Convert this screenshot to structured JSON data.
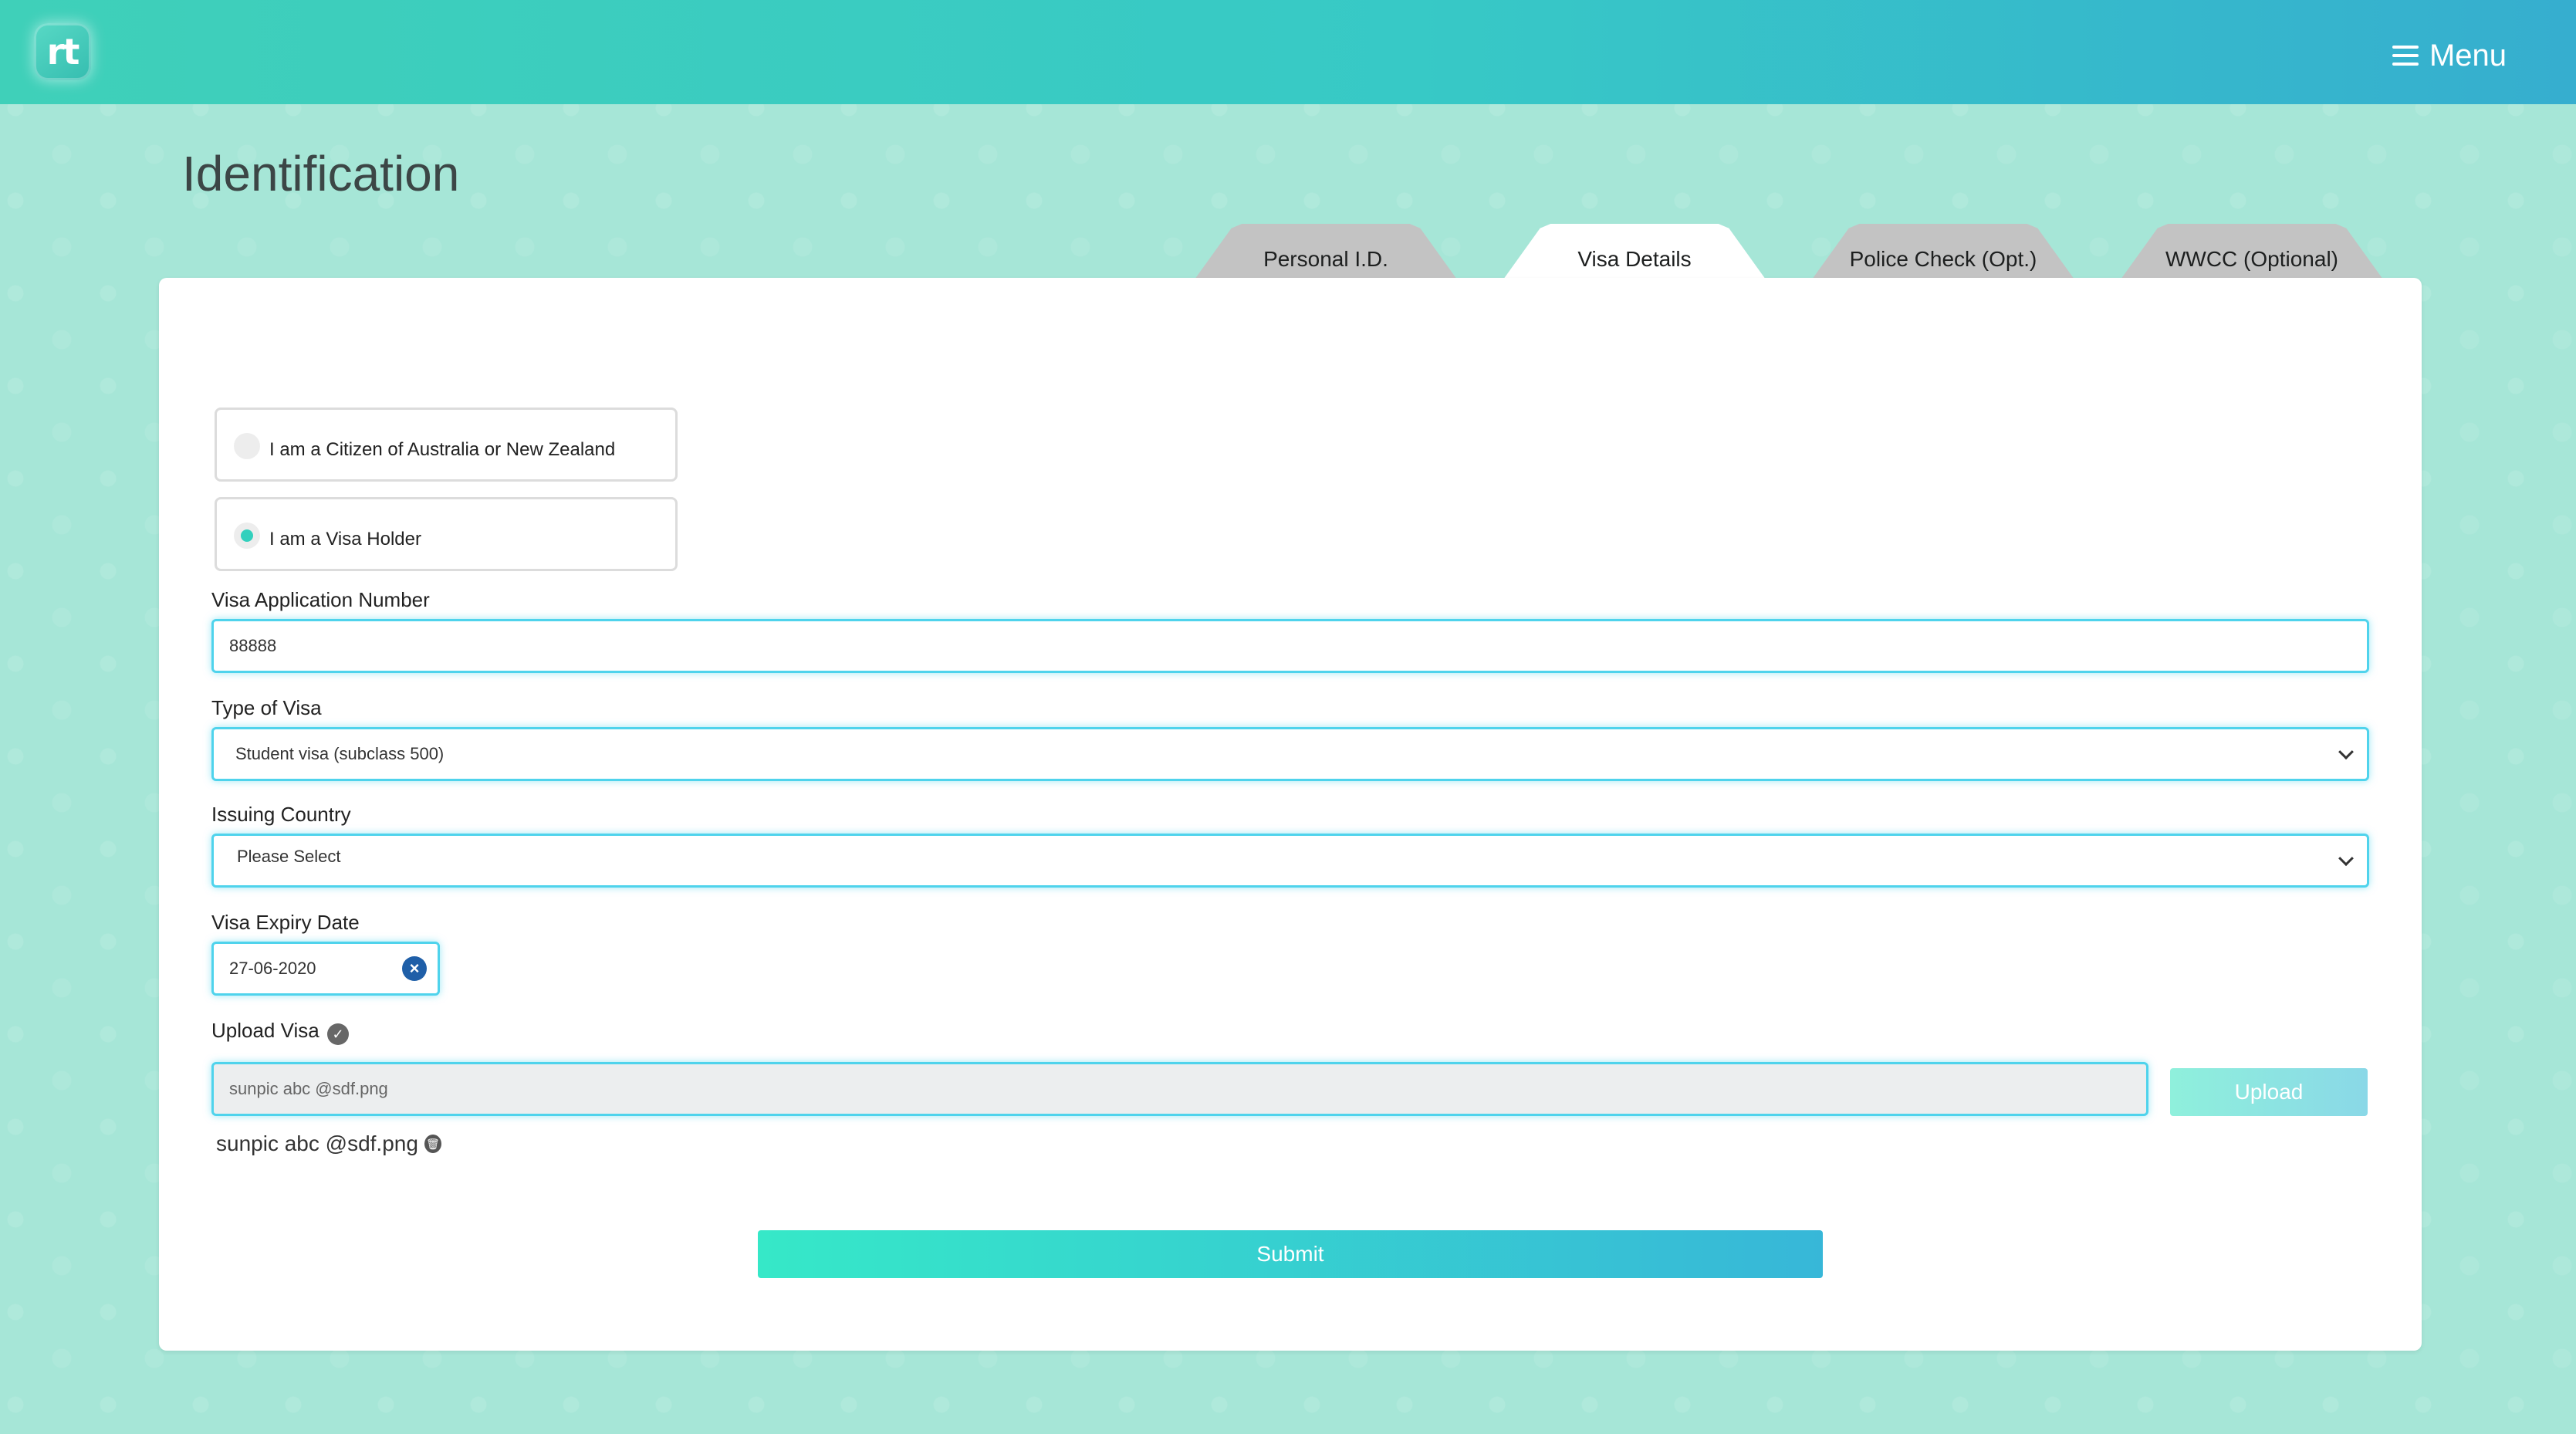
{
  "header": {
    "logo_text": "rt",
    "menu_label": "Menu"
  },
  "page": {
    "title": "Identification"
  },
  "tabs": [
    {
      "label": "Personal I.D."
    },
    {
      "label": "Visa Details"
    },
    {
      "label": "Police Check (Opt.)"
    },
    {
      "label": "WWCC (Optional)"
    }
  ],
  "citizenship": {
    "options": [
      {
        "label": "I am a Citizen of Australia or New Zealand",
        "checked": false
      },
      {
        "label": "I am a Visa Holder",
        "checked": true
      }
    ]
  },
  "form": {
    "visa_application_number": {
      "label": "Visa Application Number",
      "value": "88888"
    },
    "type_of_visa": {
      "label": "Type of Visa",
      "value": "Student visa (subclass 500)"
    },
    "issuing_country": {
      "label": "Issuing Country",
      "value": "Please Select"
    },
    "visa_expiry_date": {
      "label": "Visa Expiry Date",
      "value": "27-06-2020"
    },
    "upload_visa": {
      "label": "Upload Visa",
      "file_name": "sunpic abc @sdf.png",
      "button_label": "Upload",
      "uploaded_file": "sunpic abc @sdf.png"
    },
    "submit_label": "Submit"
  },
  "colors": {
    "accent": "#33d0bd",
    "focus_border": "#4fd3ec",
    "background": "#a6e6d7"
  }
}
